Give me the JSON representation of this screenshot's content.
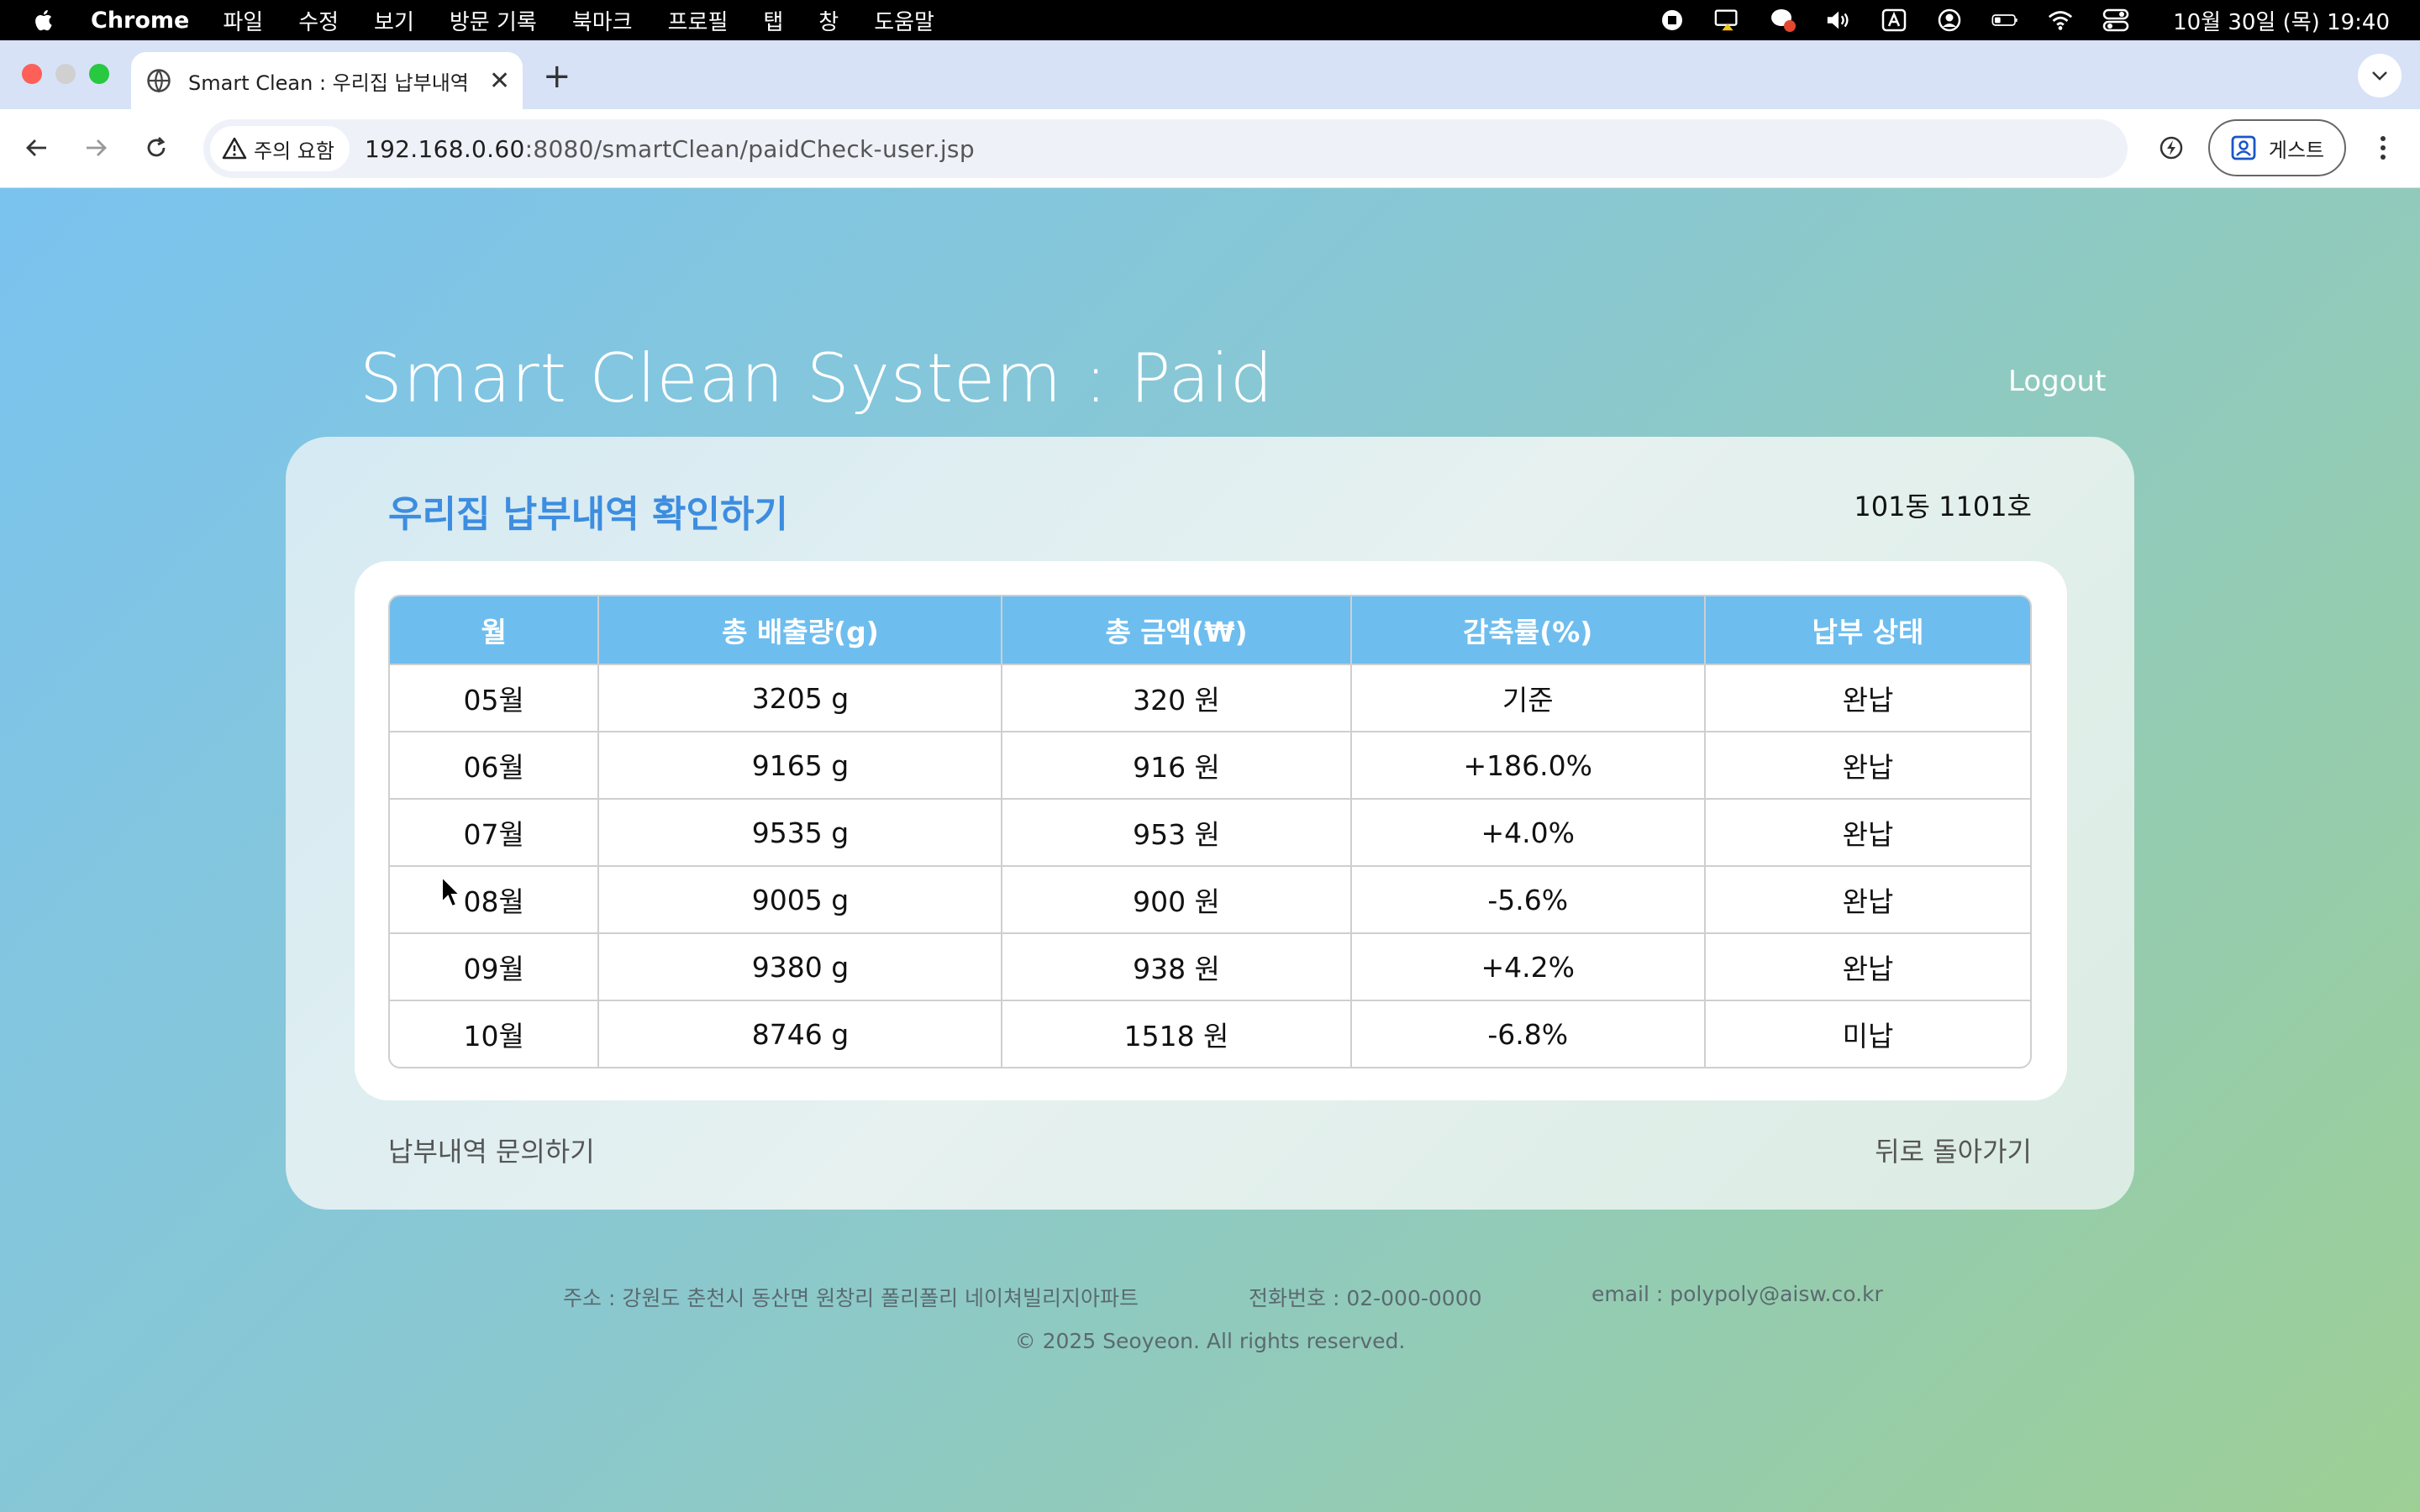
{
  "menubar": {
    "app_name": "Chrome",
    "items": [
      "파일",
      "수정",
      "보기",
      "방문 기록",
      "북마크",
      "프로필",
      "탭",
      "창",
      "도움말"
    ],
    "clock": "10월 30일 (목) 19:40"
  },
  "browser": {
    "tab_title": "Smart Clean : 우리집 납부내역 확",
    "security_label": "주의 요함",
    "url_host": "192.168.0.60",
    "url_path": ":8080/smartClean/paidCheck-user.jsp",
    "profile_label": "게스트"
  },
  "page": {
    "title": "Smart Clean System : Paid",
    "logout": "Logout",
    "card_title": "우리집 납부내역 확인하기",
    "unit": "101동 1101호",
    "table": {
      "headers": [
        "월",
        "총 배출량(g)",
        "총 금액(₩)",
        "감축률(%)",
        "납부 상태"
      ],
      "rows": [
        [
          "05월",
          "3205 g",
          "320 원",
          "기준",
          "완납"
        ],
        [
          "06월",
          "9165 g",
          "916 원",
          "+186.0%",
          "완납"
        ],
        [
          "07월",
          "9535 g",
          "953 원",
          "+4.0%",
          "완납"
        ],
        [
          "08월",
          "9005 g",
          "900 원",
          "-5.6%",
          "완납"
        ],
        [
          "09월",
          "9380 g",
          "938 원",
          "+4.2%",
          "완납"
        ],
        [
          "10월",
          "8746 g",
          "1518 원",
          "-6.8%",
          "미납"
        ]
      ]
    },
    "inquiry_link": "납부내역 문의하기",
    "back_link": "뒤로 돌아가기"
  },
  "footer": {
    "address": "주소 : 강원도 춘천시 동산면 원창리 폴리폴리 네이쳐빌리지아파트",
    "phone": "전화번호 : 02-000-0000",
    "email": "email : polypoly@aisw.co.kr",
    "copyright": "© 2025 Seoyeon. All rights reserved."
  }
}
